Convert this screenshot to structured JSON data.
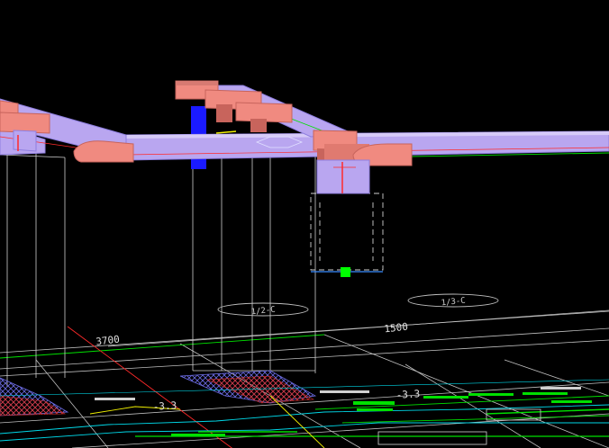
{
  "viewport": {
    "kind": "3D CAD model viewport",
    "background": "#000000"
  },
  "colors": {
    "duct_fill": "#b9a6f0",
    "duct_edge": "#8f7fe0",
    "elbow_fill": "#f08a80",
    "elbow_dark": "#c8645c",
    "column_blue": "#1a1aff",
    "grip_green": "#00ff00",
    "grid_line": "#bfbfbf",
    "wire_line": "#cfcfcf",
    "red_line": "#ff2a2a",
    "green_line": "#00e000",
    "cyan_line": "#00d8e8",
    "yellow_line": "#f0f000",
    "hatch": "#d03030"
  },
  "dimensions": [
    {
      "label": "3700"
    },
    {
      "label": "1500"
    }
  ],
  "grid_bubbles": [
    {
      "label": "1/2-C"
    },
    {
      "label": "1/3-C"
    }
  ],
  "annotations": [
    {
      "label": "-3.3"
    },
    {
      "label": "-3.3"
    }
  ],
  "grip": {
    "icon": "grip-square-icon"
  }
}
